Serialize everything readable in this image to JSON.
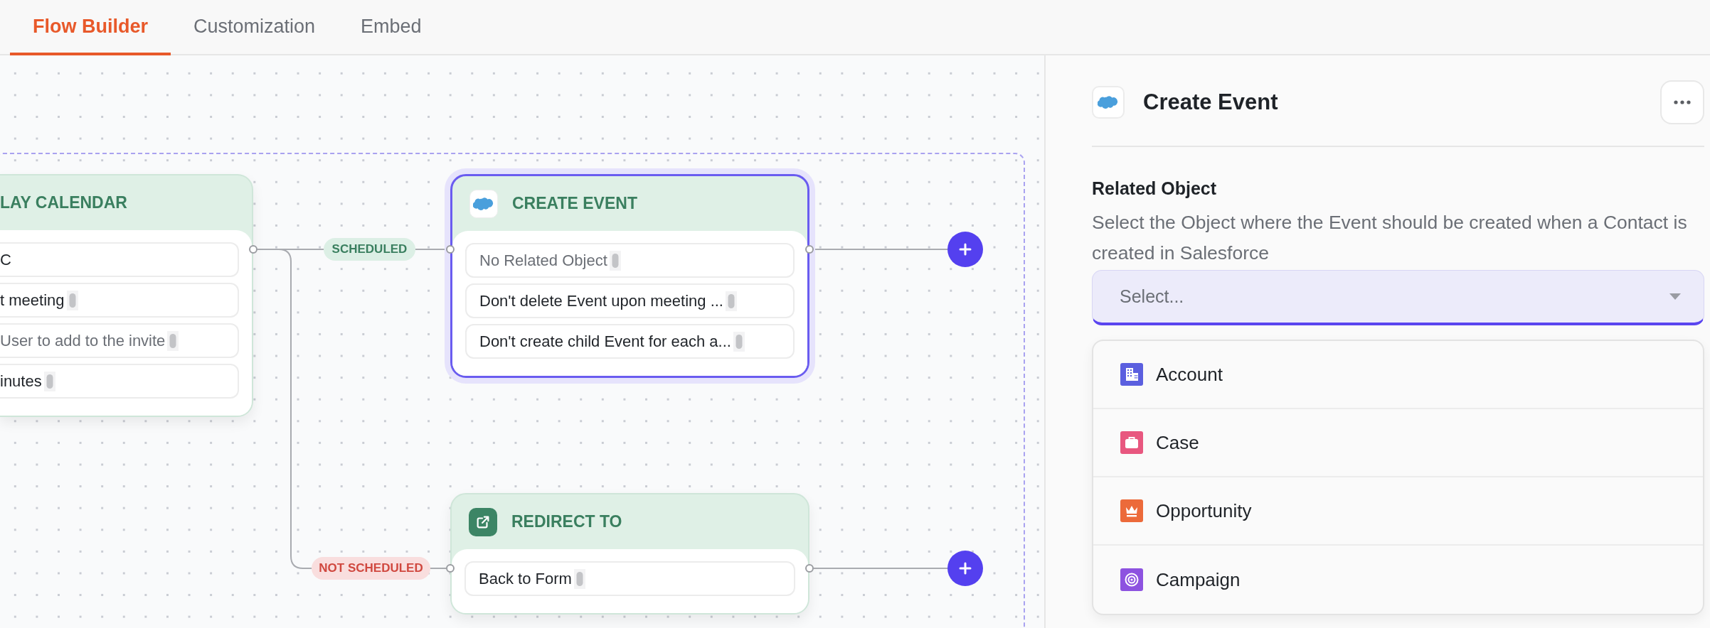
{
  "tabs": [
    {
      "label": "Flow Builder",
      "selected": true
    },
    {
      "label": "Customization",
      "selected": false
    },
    {
      "label": "Embed",
      "selected": false
    }
  ],
  "canvas": {
    "nodes": [
      {
        "kind": "plain",
        "title": "LAY CALENDAR",
        "selected": false,
        "rows": [
          {
            "text": "C",
            "empty": false,
            "token": false
          },
          {
            "text": "t meeting",
            "empty": false,
            "token": true
          },
          {
            "text": "User to add to the invite",
            "empty": true,
            "token": true
          },
          {
            "text": "inutes",
            "empty": false,
            "token": true
          }
        ]
      },
      {
        "kind": "salesforce",
        "title": "CREATE EVENT",
        "selected": true,
        "rows": [
          {
            "text": "No Related Object",
            "empty": true,
            "token": true
          },
          {
            "text": "Don't delete Event upon meeting ...",
            "empty": false,
            "token": true
          },
          {
            "text": "Don't create child Event for each a...",
            "empty": false,
            "token": true
          }
        ]
      },
      {
        "kind": "redirect",
        "title": "REDIRECT TO",
        "selected": false,
        "rows": [
          {
            "text": "Back to Form",
            "empty": false,
            "token": true
          }
        ]
      }
    ],
    "edges": [
      {
        "label": "SCHEDULED",
        "kind": "success"
      },
      {
        "label": "NOT SCHEDULED",
        "kind": "failure"
      }
    ]
  },
  "panel": {
    "title": "Create Event",
    "field": {
      "label": "Related Object",
      "description": "Select the Object where the Event should be created when a Contact is created in Salesforce",
      "placeholder": "Select..."
    },
    "options": [
      {
        "label": "Account",
        "kind": "building",
        "color": "#5b5fdf",
        "selected": false
      },
      {
        "label": "Case",
        "kind": "briefcase",
        "color": "#e8577f",
        "selected": false
      },
      {
        "label": "Opportunity",
        "kind": "crown",
        "color": "#ec6a3a",
        "selected": false
      },
      {
        "label": "Campaign",
        "kind": "target",
        "color": "#8d52e0",
        "selected": false
      }
    ]
  }
}
